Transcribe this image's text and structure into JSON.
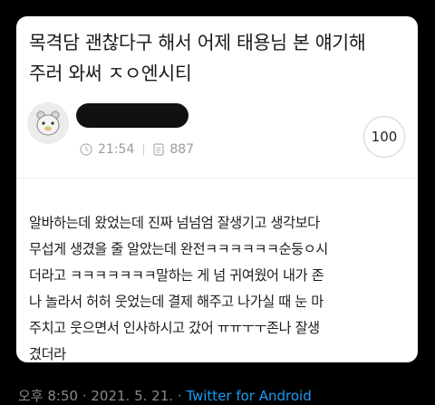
{
  "post": {
    "title": "목격담 괜찮다구 해서 어제 태용님 본 얘기해\n주러 와써 ㅈㅇ엔시티",
    "time": "21:54",
    "views": "887",
    "comment_count": "100",
    "body": "알바하는데 왔었는데 진짜 넘넘엄 잘생기고 생각보다\n무섭게 생겼을 줄 알았는데 완전ㅋㅋㅋㅋㅋㅋ순둥ㅇ시\n더라고 ㅋㅋㅋㅋㅋㅋㅋ말하는 게 넘 귀여웠어 내가 존\n나 놀라서 허허 웃었는데 결제 해주고 나가실 때 눈 마\n주치고 웃으면서 인사하시고 갔어 ㅠㅠㅜㅜ존나 잘생\n겼더라"
  },
  "icons": {
    "avatar": "bear-avatar-icon",
    "time": "clock-icon",
    "views": "document-icon"
  },
  "tweet_footer": {
    "timestamp": "오후 8:50 · 2021. 5. 21. · ",
    "app": "Twitter for Android"
  },
  "colors": {
    "background": "#000000",
    "card": "#ffffff",
    "meta_text": "#9a9a9a",
    "link": "#1d9bf0"
  }
}
